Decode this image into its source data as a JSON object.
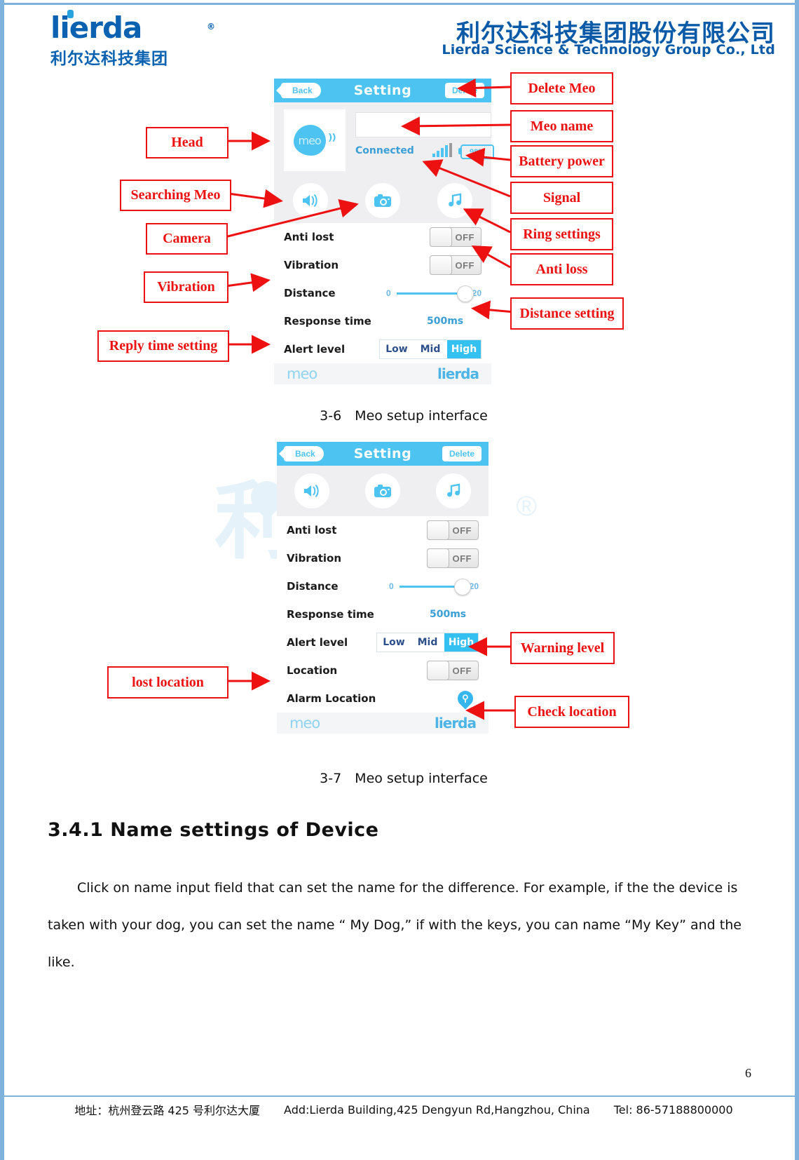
{
  "header": {
    "logo_word": "lierda",
    "logo_reg": "®",
    "logo_cn": "利尔达科技集团",
    "company_cn": "利尔达科技集团股份有限公司",
    "company_en": "Lierda Science & Technology Group Co., Ltd"
  },
  "watermark": {
    "text_cn": "利尔达",
    "reg": "®"
  },
  "figure1": {
    "topbar": {
      "back": "Back",
      "title": "Setting",
      "delete": "Delete"
    },
    "device": {
      "logo_text": "meo",
      "name_value": "",
      "status": "Connected",
      "battery": "98%"
    },
    "actions": [
      "speaker-icon",
      "camera-icon",
      "music-icon"
    ],
    "rows": [
      {
        "label": "Anti lost",
        "control": "toggle",
        "value": "OFF"
      },
      {
        "label": "Vibration",
        "control": "toggle",
        "value": "OFF"
      },
      {
        "label": "Distance",
        "control": "slider",
        "min": "0",
        "max": "20",
        "value": "20"
      },
      {
        "label": "Response time",
        "control": "text",
        "value": "500ms"
      },
      {
        "label": "Alert level",
        "control": "segment",
        "options": [
          "Low",
          "Mid",
          "High"
        ],
        "value": "High"
      }
    ],
    "brandbar": {
      "left": "meo",
      "right": "lierda"
    },
    "caption": "3-6　Meo setup interface",
    "annotations_left": [
      "Head",
      "Searching Meo",
      "Camera",
      "Vibration",
      "Reply time setting"
    ],
    "annotations_right": [
      "Delete Meo",
      "Meo name",
      "Battery power",
      "Signal",
      "Ring settings",
      "Anti loss",
      "Distance setting"
    ]
  },
  "figure2": {
    "topbar": {
      "back": "Back",
      "title": "Setting",
      "delete": "Delete"
    },
    "actions": [
      "speaker-icon",
      "camera-icon",
      "music-icon"
    ],
    "rows": [
      {
        "label": "Anti lost",
        "control": "toggle",
        "value": "OFF"
      },
      {
        "label": "Vibration",
        "control": "toggle",
        "value": "OFF"
      },
      {
        "label": "Distance",
        "control": "slider",
        "min": "0",
        "max": "20",
        "value": "20"
      },
      {
        "label": "Response time",
        "control": "text",
        "value": "500ms"
      },
      {
        "label": "Alert level",
        "control": "segment",
        "options": [
          "Low",
          "Mid",
          "High"
        ],
        "value": "High"
      },
      {
        "label": "Location",
        "control": "toggle",
        "value": "OFF"
      },
      {
        "label": "Alarm Location",
        "control": "pin",
        "value": "location-pin-icon"
      }
    ],
    "brandbar": {
      "left": "meo",
      "right": "lierda"
    },
    "caption": "3-7　Meo setup interface",
    "annotations_left": [
      "lost location"
    ],
    "annotations_right": [
      "Warning level",
      "Check location"
    ]
  },
  "section": {
    "heading": "3.4.1 Name settings of Device",
    "paragraph": "Click on name input field that can set the name for the difference. For example, if the the device is taken with your dog, you can set the name “ My Dog,” if with the keys, you can name “My Key” and the like."
  },
  "footer": {
    "address_cn": "地址：杭州登云路 425 号利尔达大厦",
    "address_en": "Add:Lierda Building,425 Dengyun Rd,Hangzhou, China",
    "tel": "Tel: 86-57188800000",
    "page_number": "6"
  },
  "colors": {
    "brand_blue": "#0a5aa8",
    "accent_cyan": "#4cc3f0",
    "annotation_red": "#ee1111",
    "page_border": "#7fb3de"
  }
}
